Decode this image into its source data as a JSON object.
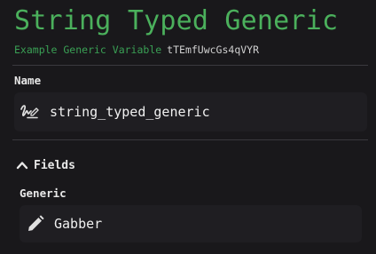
{
  "header": {
    "title": "String Typed Generic",
    "kind_label": "Example Generic Variable",
    "uid": "tTEmfUwcGs4qVYR"
  },
  "name_section": {
    "label": "Name",
    "value": "string_typed_generic",
    "icon": "signature-icon"
  },
  "fields_section": {
    "toggle_label": "Fields",
    "toggle_icon": "chevron-up-icon",
    "generic": {
      "label": "Generic",
      "value": "Gabber",
      "icon": "pencil-icon"
    }
  },
  "colors": {
    "background": "#19181b",
    "accent_green": "#4bb05c",
    "field_bg": "#1f1e22",
    "divider": "#3a393e"
  }
}
